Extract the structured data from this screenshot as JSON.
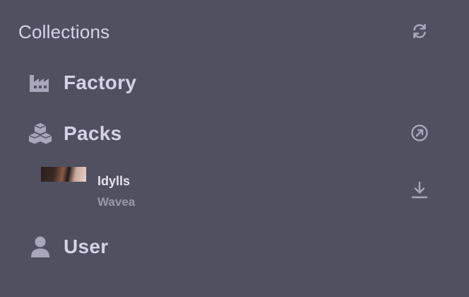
{
  "sidebar": {
    "title": "Collections",
    "refresh_icon": "refresh-icon",
    "items": [
      {
        "label": "Factory",
        "icon": "factory-icon"
      },
      {
        "label": "Packs",
        "icon": "boxes-icon",
        "action_icon": "open-external-icon"
      },
      {
        "label": "User",
        "icon": "user-icon"
      }
    ],
    "packs": [
      {
        "name": "Idylls",
        "author": "Wavea",
        "action_icon": "download-icon"
      }
    ]
  },
  "colors": {
    "background": "#515061",
    "text_primary": "#d6d2e6",
    "text_secondary": "#9a98aa",
    "icon": "#a9a6bb"
  }
}
